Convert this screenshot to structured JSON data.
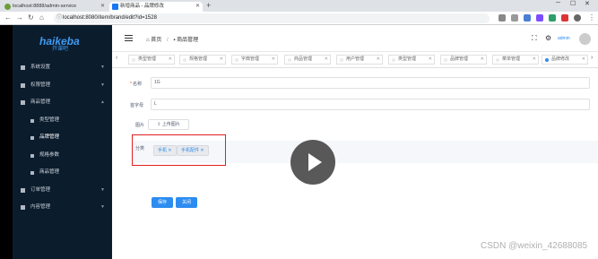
{
  "browser": {
    "tabs": [
      {
        "title": "localhost:8888/admin-service",
        "active": false
      },
      {
        "title": "新增商品 - 品牌修改",
        "active": true
      }
    ],
    "url": "localhost:8080/item/brand/edit?id=1528"
  },
  "app": {
    "logo": {
      "brand": "haikeba",
      "sub": "开课吧"
    },
    "sidebar": [
      {
        "label": "系统设置",
        "sub": false
      },
      {
        "label": "权限管理",
        "sub": false
      },
      {
        "label": "商品管理",
        "sub": false
      },
      {
        "label": "类型管理",
        "sub": true
      },
      {
        "label": "品牌管理",
        "sub": true
      },
      {
        "label": "规格参数",
        "sub": true
      },
      {
        "label": "商品管理",
        "sub": true
      },
      {
        "label": "订单管理",
        "sub": false
      },
      {
        "label": "内容管理",
        "sub": false
      }
    ],
    "breadcrumb": {
      "home": "首页",
      "current": "商品管理"
    },
    "user": "admin",
    "tags": [
      "类型管理",
      "规格管理",
      "字典管理",
      "商品管理",
      "用户管理",
      "类型管理",
      "品牌管理",
      "菜单管理",
      "品牌修改"
    ],
    "form": {
      "name_label": "名称",
      "name_value": "1G",
      "initial_label": "首字母",
      "initial_value": "L",
      "image_label": "图片",
      "upload_label": "上传图片",
      "category_label": "分类",
      "categories": [
        "手机",
        "手机配件"
      ],
      "save_label": "保存",
      "close_label": "关闭"
    }
  },
  "watermark": "CSDN @weixin_42688085"
}
